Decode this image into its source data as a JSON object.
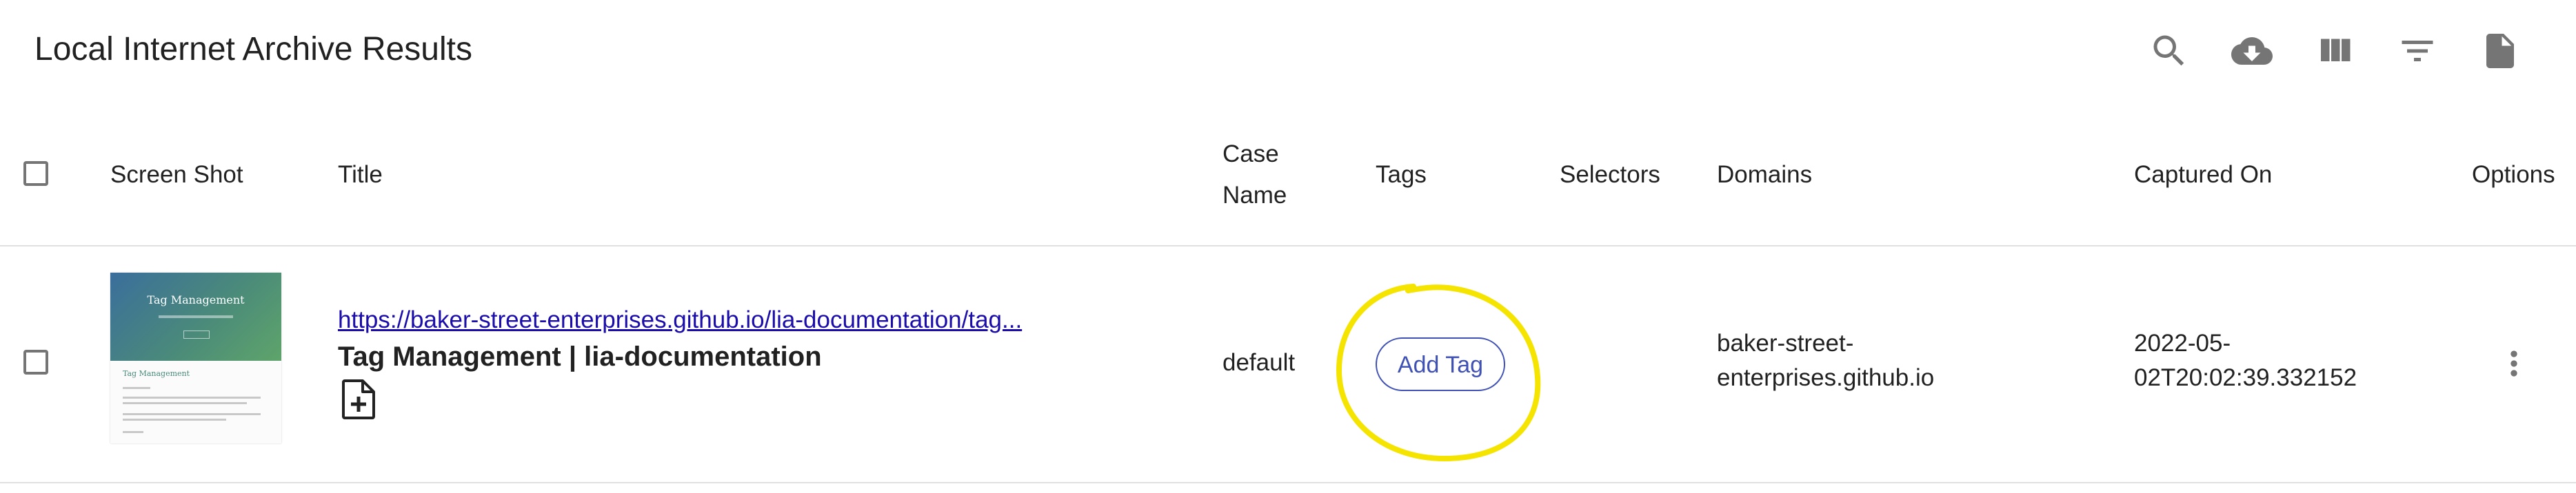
{
  "toolbar": {
    "title": "Local Internet Archive Results",
    "icons": [
      "search-icon",
      "cloud-download-icon",
      "view-column-icon",
      "filter-list-icon",
      "description-icon"
    ]
  },
  "table": {
    "columns": {
      "screenshot": "Screen Shot",
      "title": "Title",
      "case_name_line1": "Case",
      "case_name_line2": "Name",
      "tags": "Tags",
      "selectors": "Selectors",
      "domains": "Domains",
      "captured_on": "Captured On",
      "options": "Options"
    },
    "rows": [
      {
        "screenshot_thumb_title": "Tag Management",
        "screenshot_thumb_subtitle": "Tag Management",
        "url": "https://baker-street-enterprises.github.io/lia-documentation/tag...",
        "page_title": "Tag Management | lia-documentation",
        "case_name": "default",
        "add_tag_label": "Add Tag",
        "domain_line1": "baker-street-",
        "domain_line2": "enterprises.github.io",
        "captured_line1": "2022-05-",
        "captured_line2": "02T20:02:39.332152"
      }
    ]
  },
  "colors": {
    "link": "#1a0dab",
    "primary": "#3f51b5",
    "highlight": "#f5e400"
  }
}
